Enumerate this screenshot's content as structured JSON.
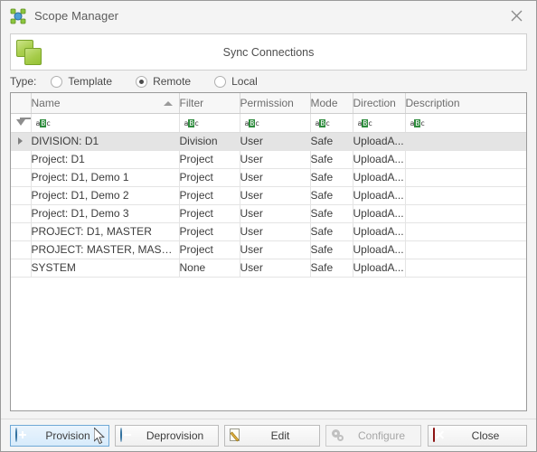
{
  "window": {
    "title": "Scope Manager",
    "title_icon": "network-nodes-icon",
    "close_icon": "close-icon"
  },
  "sync_banner": {
    "label": "Sync Connections",
    "icon": "two-green-squares-icon"
  },
  "type_selector": {
    "label": "Type:",
    "options": [
      {
        "label": "Template",
        "selected": false
      },
      {
        "label": "Remote",
        "selected": true
      },
      {
        "label": "Local",
        "selected": false
      }
    ]
  },
  "grid": {
    "columns": [
      {
        "key": "name",
        "label": "Name",
        "sorted": true,
        "sort_direction": "asc"
      },
      {
        "key": "filter",
        "label": "Filter"
      },
      {
        "key": "permission",
        "label": "Permission"
      },
      {
        "key": "mode",
        "label": "Mode"
      },
      {
        "key": "direction",
        "label": "Direction"
      },
      {
        "key": "description",
        "label": "Description"
      }
    ],
    "filter_row": {
      "funnel_icon": "filter-funnel-icon",
      "cells": [
        "aBc",
        "aBc",
        "aBc",
        "aBc",
        "aBc",
        "aBc"
      ]
    },
    "rows": [
      {
        "selected": true,
        "name": "DIVISION: D1",
        "filter": "Division",
        "permission": "User",
        "mode": "Safe",
        "direction": "UploadA...",
        "description": ""
      },
      {
        "selected": false,
        "name": "Project: D1",
        "filter": "Project",
        "permission": "User",
        "mode": "Safe",
        "direction": "UploadA...",
        "description": ""
      },
      {
        "selected": false,
        "name": "Project: D1, Demo 1",
        "filter": "Project",
        "permission": "User",
        "mode": "Safe",
        "direction": "UploadA...",
        "description": ""
      },
      {
        "selected": false,
        "name": "Project: D1, Demo 2",
        "filter": "Project",
        "permission": "User",
        "mode": "Safe",
        "direction": "UploadA...",
        "description": ""
      },
      {
        "selected": false,
        "name": "Project: D1, Demo 3",
        "filter": "Project",
        "permission": "User",
        "mode": "Safe",
        "direction": "UploadA...",
        "description": ""
      },
      {
        "selected": false,
        "name": "PROJECT: D1, MASTER",
        "filter": "Project",
        "permission": "User",
        "mode": "Safe",
        "direction": "UploadA...",
        "description": ""
      },
      {
        "selected": false,
        "name": "PROJECT: MASTER, MASTER",
        "filter": "Project",
        "permission": "User",
        "mode": "Safe",
        "direction": "UploadA...",
        "description": ""
      },
      {
        "selected": false,
        "name": "SYSTEM",
        "filter": "None",
        "permission": "User",
        "mode": "Safe",
        "direction": "UploadA...",
        "description": ""
      }
    ]
  },
  "buttons": {
    "provision": {
      "label": "Provision",
      "icon": "plus-circle-icon",
      "state": "hover"
    },
    "deprovision": {
      "label": "Deprovision",
      "icon": "minus-circle-icon",
      "state": "normal"
    },
    "edit": {
      "label": "Edit",
      "icon": "pencil-page-icon",
      "state": "normal"
    },
    "configure": {
      "label": "Configure",
      "icon": "gears-icon",
      "state": "disabled"
    },
    "close": {
      "label": "Close",
      "icon": "red-x-icon",
      "state": "normal"
    }
  },
  "colors": {
    "window_background": "#f4f4f4",
    "grid_background": "#ffffff",
    "selection": "#e4e4e4",
    "accent_green": "#9cc63f",
    "accent_blue": "#2e7ebb",
    "danger_red": "#c22020",
    "filter_highlight": "#2e8b3d"
  }
}
